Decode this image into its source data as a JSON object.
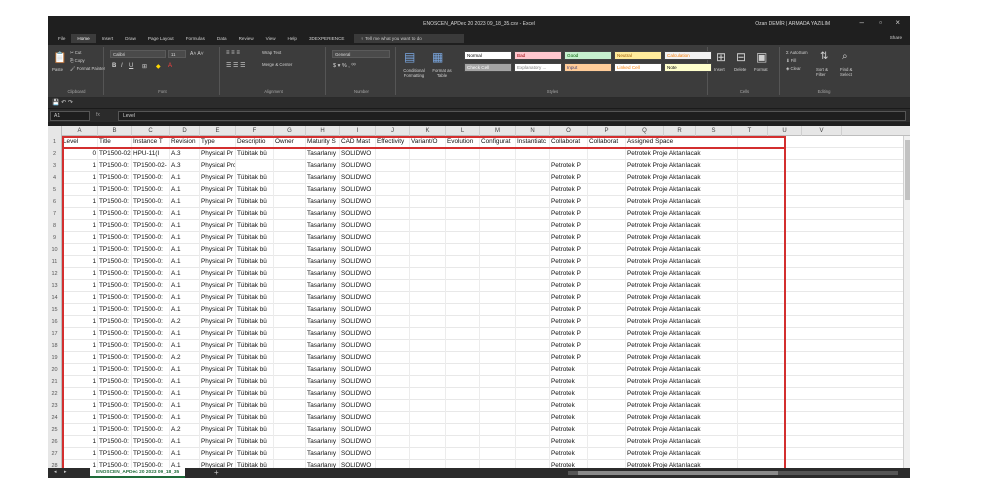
{
  "window": {
    "title": "ENOSCEN_APDec 20 2023 09_18_35.csv - Excel",
    "user": "Ozan DEMİR | ARMADA YAZILIM"
  },
  "tabs": {
    "items": [
      "File",
      "Home",
      "Insert",
      "Draw",
      "Page Layout",
      "Formulas",
      "Data",
      "Review",
      "View",
      "Help",
      "3DEXPERIENCE"
    ],
    "active": "Home",
    "tellme": "Tell me what you want to do",
    "share": "Share"
  },
  "ribbon": {
    "clipboard": {
      "paste": "Paste",
      "cut": "Cut",
      "copy": "Copy",
      "format_painter": "Format Painter",
      "label": "Clipboard"
    },
    "font": {
      "name": "Calibri",
      "size": "11",
      "label": "Font"
    },
    "alignment": {
      "wrap": "Wrap Text",
      "merge": "Merge & Center",
      "label": "Alignment"
    },
    "number": {
      "format": "General",
      "label": "Number"
    },
    "styles": {
      "conditional": "Conditional Formatting",
      "format_as_table": "Format as Table",
      "cells": [
        {
          "text": "Normal",
          "bg": "#ffffff",
          "fg": "#000000"
        },
        {
          "text": "Bad",
          "bg": "#ffc7ce",
          "fg": "#9c0006"
        },
        {
          "text": "Good",
          "bg": "#c6efce",
          "fg": "#006100"
        },
        {
          "text": "Neutral",
          "bg": "#ffeb9c",
          "fg": "#9c5700"
        },
        {
          "text": "Calculation",
          "bg": "#f2f2f2",
          "fg": "#fa7d00"
        },
        {
          "text": "Check Cell",
          "bg": "#a5a5a5",
          "fg": "#ffffff"
        },
        {
          "text": "Explanatory ...",
          "bg": "#ffffff",
          "fg": "#7f7f7f"
        },
        {
          "text": "Input",
          "bg": "#ffcc99",
          "fg": "#3f3f76"
        },
        {
          "text": "Linked Cell",
          "bg": "#ffffff",
          "fg": "#fa7d00"
        },
        {
          "text": "Note",
          "bg": "#ffffcc",
          "fg": "#000000"
        }
      ],
      "label": "Styles"
    },
    "cells": {
      "insert": "Insert",
      "delete": "Delete",
      "format": "Format",
      "label": "Cells"
    },
    "editing": {
      "autosum": "AutoSum",
      "fill": "Fill",
      "clear": "Clear",
      "sort": "Sort & Filter",
      "find": "Find & Select",
      "label": "Editing"
    }
  },
  "formula_bar": {
    "name_box": "A1",
    "fx": "fx",
    "content": "Level"
  },
  "sheet": {
    "columns": [
      "A",
      "B",
      "C",
      "D",
      "E",
      "F",
      "G",
      "H",
      "I",
      "J",
      "K",
      "L",
      "M",
      "N",
      "O",
      "P",
      "Q",
      "R",
      "S",
      "T",
      "U",
      "V"
    ],
    "header": [
      "Level",
      "Title",
      "Instance T",
      "Revision",
      "Type",
      "Descriptio",
      "Owner",
      "Maturity S",
      "CAD Mast",
      "Effectivity",
      "Variant/O",
      "Evolution",
      "Configurat",
      "Instantiatc",
      "Collaborat",
      "Collaborat",
      "Assigned Space"
    ],
    "rows": [
      [
        "0",
        "TP1500-02-",
        "HPU-11(I",
        "A.3",
        "Physical Pr",
        "Tübitak bü",
        "",
        "Tasarlanıy",
        "SOLIDWO",
        "",
        "",
        "",
        "",
        "",
        "",
        "",
        "Petrotek Proje Aktarılacak"
      ],
      [
        "1",
        "TP1500-0:",
        "TP1500-02-",
        "A.3",
        "Physical Product",
        "",
        "",
        "Tasarlanıy",
        "SOLIDWO",
        "",
        "",
        "",
        "",
        "",
        "Petrotek P",
        "",
        "Petrotek Proje Aktarılacak"
      ],
      [
        "1",
        "TP1500-0:",
        "TP1500-0:",
        "A.1",
        "Physical Pr",
        "Tübitak bü",
        "",
        "Tasarlanıy",
        "SOLIDWO",
        "",
        "",
        "",
        "",
        "",
        "Petrotek P",
        "",
        "Petrotek Proje Aktarılacak"
      ],
      [
        "1",
        "TP1500-0:",
        "TP1500-0:",
        "A.1",
        "Physical Pr",
        "Tübitak bü",
        "",
        "Tasarlanıy",
        "SOLIDWO",
        "",
        "",
        "",
        "",
        "",
        "Petrotek P",
        "",
        "Petrotek Proje Aktarılacak"
      ],
      [
        "1",
        "TP1500-0:",
        "TP1500-0:",
        "A.1",
        "Physical Pr",
        "Tübitak bü",
        "",
        "Tasarlanıy",
        "SOLIDWO",
        "",
        "",
        "",
        "",
        "",
        "Petrotek P",
        "",
        "Petrotek Proje Aktarılacak"
      ],
      [
        "1",
        "TP1500-0:",
        "TP1500-0:",
        "A.1",
        "Physical Pr",
        "Tübitak bü",
        "",
        "Tasarlanıy",
        "SOLIDWO",
        "",
        "",
        "",
        "",
        "",
        "Petrotek P",
        "",
        "Petrotek Proje Aktarılacak"
      ],
      [
        "1",
        "TP1500-0:",
        "TP1500-0:",
        "A.1",
        "Physical Pr",
        "Tübitak bü",
        "",
        "Tasarlanıy",
        "SOLIDWO",
        "",
        "",
        "",
        "",
        "",
        "Petrotek P",
        "",
        "Petrotek Proje Aktarılacak"
      ],
      [
        "1",
        "TP1500-0:",
        "TP1500-0:",
        "A.1",
        "Physical Pr",
        "Tübitak bü",
        "",
        "Tasarlanıy",
        "SOLIDWO",
        "",
        "",
        "",
        "",
        "",
        "Petrotek P",
        "",
        "Petrotek Proje Aktarılacak"
      ],
      [
        "1",
        "TP1500-0:",
        "TP1500-0:",
        "A.1",
        "Physical Pr",
        "Tübitak bü",
        "",
        "Tasarlanıy",
        "SOLIDWO",
        "",
        "",
        "",
        "",
        "",
        "Petrotek P",
        "",
        "Petrotek Proje Aktarılacak"
      ],
      [
        "1",
        "TP1500-0:",
        "TP1500-0:",
        "A.1",
        "Physical Pr",
        "Tübitak bü",
        "",
        "Tasarlanıy",
        "SOLIDWO",
        "",
        "",
        "",
        "",
        "",
        "Petrotek P",
        "",
        "Petrotek Proje Aktarılacak"
      ],
      [
        "1",
        "TP1500-0:",
        "TP1500-0:",
        "A.1",
        "Physical Pr",
        "Tübitak bü",
        "",
        "Tasarlanıy",
        "SOLIDWO",
        "",
        "",
        "",
        "",
        "",
        "Petrotek P",
        "",
        "Petrotek Proje Aktarılacak"
      ],
      [
        "1",
        "TP1500-0:",
        "TP1500-0:",
        "A.1",
        "Physical Pr",
        "Tübitak bü",
        "",
        "Tasarlanıy",
        "SOLIDWO",
        "",
        "",
        "",
        "",
        "",
        "Petrotek P",
        "",
        "Petrotek Proje Aktarılacak"
      ],
      [
        "1",
        "TP1500-0:",
        "TP1500-0:",
        "A.1",
        "Physical Pr",
        "Tübitak bü",
        "",
        "Tasarlanıy",
        "SOLIDWO",
        "",
        "",
        "",
        "",
        "",
        "Petrotek P",
        "",
        "Petrotek Proje Aktarılacak"
      ],
      [
        "1",
        "TP1500-0:",
        "TP1500-0:",
        "A.1",
        "Physical Pr",
        "Tübitak bü",
        "",
        "Tasarlanıy",
        "SOLIDWO",
        "",
        "",
        "",
        "",
        "",
        "Petrotek P",
        "",
        "Petrotek Proje Aktarılacak"
      ],
      [
        "1",
        "TP1500-0:",
        "TP1500-0:",
        "A.2",
        "Physical Pr",
        "Tübitak bü",
        "",
        "Tasarlanıy",
        "SOLIDWO",
        "",
        "",
        "",
        "",
        "",
        "Petrotek P",
        "",
        "Petrotek Proje Aktarılacak"
      ],
      [
        "1",
        "TP1500-0:",
        "TP1500-0:",
        "A.1",
        "Physical Pr",
        "Tübitak bü",
        "",
        "Tasarlanıy",
        "SOLIDWO",
        "",
        "",
        "",
        "",
        "",
        "Petrotek P",
        "",
        "Petrotek Proje Aktarılacak"
      ],
      [
        "1",
        "TP1500-0:",
        "TP1500-0:",
        "A.1",
        "Physical Pr",
        "Tübitak bü",
        "",
        "Tasarlanıy",
        "SOLIDWO",
        "",
        "",
        "",
        "",
        "",
        "Petrotek P",
        "",
        "Petrotek Proje Aktarılacak"
      ],
      [
        "1",
        "TP1500-0:",
        "TP1500-0:",
        "A.2",
        "Physical Pr",
        "Tübitak bü",
        "",
        "Tasarlanıy",
        "SOLIDWO",
        "",
        "",
        "",
        "",
        "",
        "Petrotek P",
        "",
        "Petrotek Proje Aktarılacak"
      ],
      [
        "1",
        "TP1500-0:",
        "TP1500-0:",
        "A.1",
        "Physical Pr",
        "Tübitak bü",
        "",
        "Tasarlanıy",
        "SOLIDWO",
        "",
        "",
        "",
        "",
        "",
        "Petrotek",
        "",
        "Petrotek Proje Aktarılacak"
      ],
      [
        "1",
        "TP1500-0:",
        "TP1500-0:",
        "A.1",
        "Physical Pr",
        "Tübitak bü",
        "",
        "Tasarlanıy",
        "SOLIDWO",
        "",
        "",
        "",
        "",
        "",
        "Petrotek",
        "",
        "Petrotek Proje Aktarılacak"
      ],
      [
        "1",
        "TP1500-0:",
        "TP1500-0:",
        "A.1",
        "Physical Pr",
        "Tübitak bü",
        "",
        "Tasarlanıy",
        "SOLIDWO",
        "",
        "",
        "",
        "",
        "",
        "Petrotek",
        "",
        "Petrotek Proje Aktarılacak"
      ],
      [
        "1",
        "TP1500-0:",
        "TP1500-0:",
        "A.1",
        "Physical Pr",
        "Tübitak bü",
        "",
        "Tasarlanıy",
        "SOLIDWO",
        "",
        "",
        "",
        "",
        "",
        "Petrotek",
        "",
        "Petrotek Proje Aktarılacak"
      ],
      [
        "1",
        "TP1500-0:",
        "TP1500-0:",
        "A.1",
        "Physical Pr",
        "Tübitak bü",
        "",
        "Tasarlanıy",
        "SOLIDWO",
        "",
        "",
        "",
        "",
        "",
        "Petrotek",
        "",
        "Petrotek Proje Aktarılacak"
      ],
      [
        "1",
        "TP1500-0:",
        "TP1500-0:",
        "A.2",
        "Physical Pr",
        "Tübitak bü",
        "",
        "Tasarlanıy",
        "SOLIDWO",
        "",
        "",
        "",
        "",
        "",
        "Petrotek",
        "",
        "Petrotek Proje Aktarılacak"
      ],
      [
        "1",
        "TP1500-0:",
        "TP1500-0:",
        "A.1",
        "Physical Pr",
        "Tübitak bü",
        "",
        "Tasarlanıy",
        "SOLIDWO",
        "",
        "",
        "",
        "",
        "",
        "Petrotek",
        "",
        "Petrotek Proje Aktarılacak"
      ],
      [
        "1",
        "TP1500-0:",
        "TP1500-0:",
        "A.1",
        "Physical Pr",
        "Tübitak bü",
        "",
        "Tasarlanıy",
        "SOLIDWO",
        "",
        "",
        "",
        "",
        "",
        "Petrotek",
        "",
        "Petrotek Proje Aktarılacak"
      ],
      [
        "1",
        "TP1500-0:",
        "TP1500-0:",
        "A.1",
        "Physical Pr",
        "Tübitak bü",
        "",
        "Tasarlanıy",
        "SOLIDWO",
        "",
        "",
        "",
        "",
        "",
        "Petrotek",
        "",
        "Petrotek Proje Aktarılacak"
      ]
    ]
  },
  "sheet_tabs": {
    "active": "ENOSCEN_APDec 20 2023 09_18_35",
    "add": "+"
  }
}
